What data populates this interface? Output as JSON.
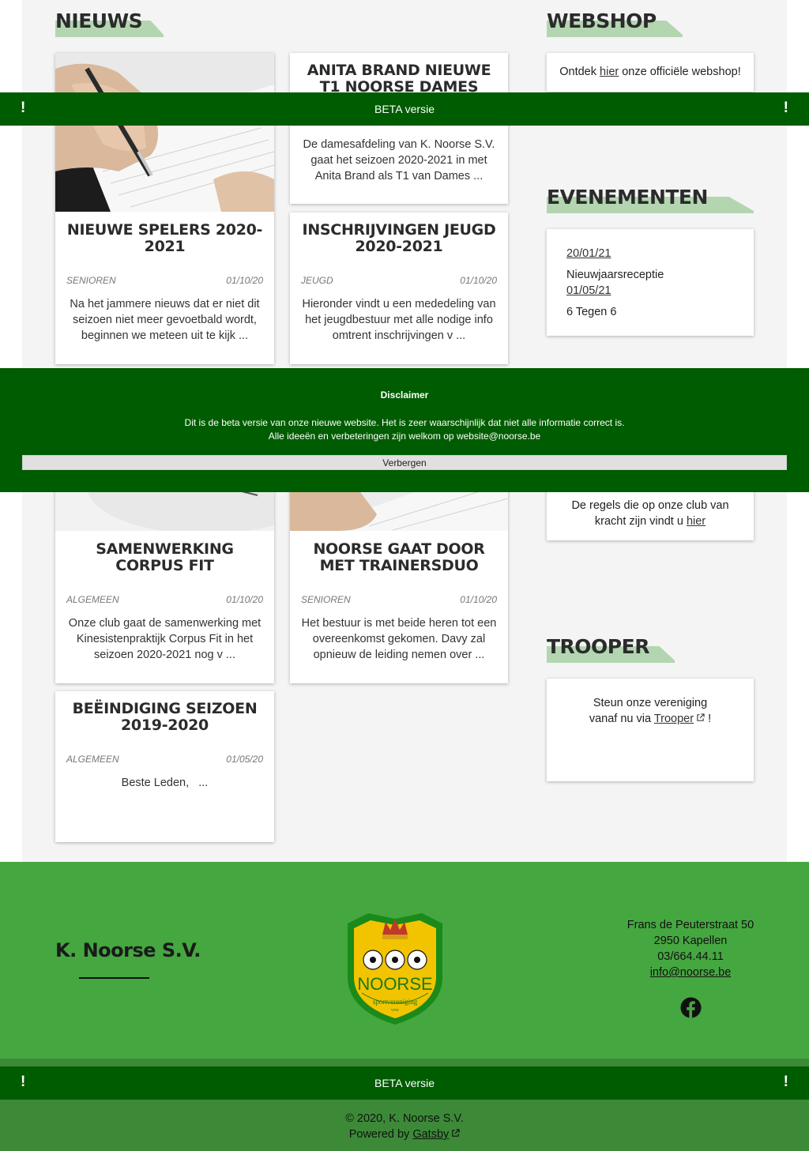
{
  "nieuws": {
    "heading": "NIEUWS",
    "articles": [
      {
        "title": "NIEUWE SPELERS 2020-2021",
        "category": "SENIOREN",
        "date": "01/10/20",
        "excerpt": "Na het jammere nieuws dat er niet dit seizoen niet meer gevoetbald wordt, beginnen we meteen uit te kijk ..."
      },
      {
        "title": "ANITA BRAND NIEUWE T1 NOORSE DAMES",
        "category": "",
        "date": "",
        "excerpt": "De damesafdeling van K. Noorse S.V. gaat het seizoen 2020-2021 in met Anita Brand als T1 van Dames ..."
      },
      {
        "title": "INSCHRIJVINGEN JEUGD 2020-2021",
        "category": "JEUGD",
        "date": "01/10/20",
        "excerpt": "Hieronder vindt u een mededeling van het jeugdbestuur met alle nodige info omtrent inschrijvingen v ..."
      },
      {
        "title": "SAMENWERKING CORPUS FIT",
        "category": "ALGEMEEN",
        "date": "01/10/20",
        "excerpt": "Onze club gaat de samenwerking met Kinesistenpraktijk Corpus Fit in het seizoen 2020-2021 nog v ..."
      },
      {
        "title": "NOORSE GAAT DOOR MET TRAINERSDUO",
        "category": "SENIOREN",
        "date": "01/10/20",
        "excerpt": "Het bestuur is met beide heren tot een overeenkomst gekomen. Davy zal opnieuw de leiding nemen over ..."
      },
      {
        "title": "BEËINDIGING SEIZOEN 2019-2020",
        "category": "ALGEMEEN",
        "date": "01/05/20",
        "excerpt": "Beste Leden,   ..."
      }
    ]
  },
  "webshop": {
    "heading": "WEBSHOP",
    "text_before": "Ontdek ",
    "link": "hier",
    "text_after": " onze officiële webshop!"
  },
  "evenementen": {
    "heading": "EVENEMENTEN",
    "items": [
      {
        "date": "20/01/21",
        "name": "Nieuwjaarsreceptie"
      },
      {
        "date": "01/05/21",
        "name": "6 Tegen 6"
      }
    ]
  },
  "reglement": {
    "text_line1": "De regels die op onze club van",
    "text_before": "kracht zijn vindt u ",
    "link": "hier"
  },
  "trooper": {
    "heading": "TROOPER",
    "text_line1": "Steun onze vereniging",
    "text_before": "vanaf nu via ",
    "link": "Trooper",
    "text_after": " !"
  },
  "beta": {
    "label": "BETA versie",
    "bang": "!"
  },
  "disclaimer": {
    "title": "Disclaimer",
    "line1": "Dit is de beta versie van onze nieuwe website. Het is zeer waarschijnlijk dat niet alle informatie correct is.",
    "line2": "Alle ideeën en verbeteringen zijn welkom op website@noorse.be",
    "button": "Verbergen"
  },
  "footer": {
    "club_name": "K. Noorse S.V.",
    "logo_text": "NOORSE",
    "logo_sub": "sportvereniging",
    "logo_sub2": "vzw",
    "address": "Frans de Peuterstraat 50",
    "city": "2950 Kapellen",
    "phone": "03/664.44.11",
    "email": "info@noorse.be",
    "facebook_icon": "facebook-icon"
  },
  "bottom": {
    "copyright": "© 2020, K. Noorse S.V.",
    "powered_prefix": "Powered by ",
    "powered_link": "Gatsby"
  },
  "colors": {
    "beta_green": "#005c00",
    "footer_green": "#45a740",
    "bottom_green": "#3c8a38",
    "heading_accent": "#b3d6b1"
  }
}
